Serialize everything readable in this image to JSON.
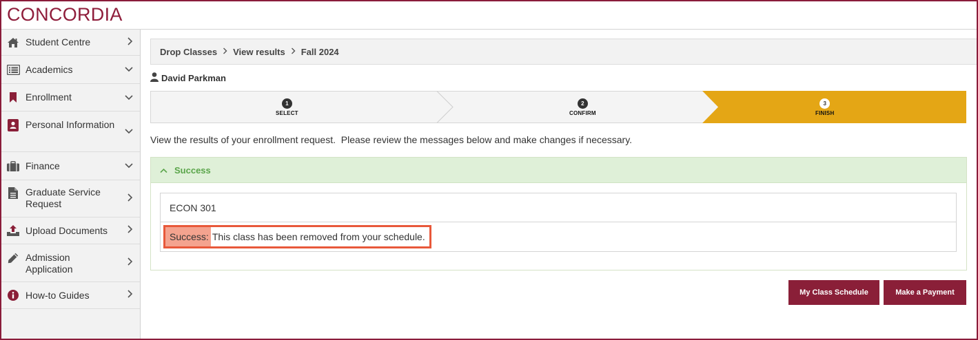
{
  "header": {
    "logo_text": "CONCORDIA",
    "brand_color": "#8f1d3b"
  },
  "sidebar": {
    "items": [
      {
        "label": "Student Centre",
        "icon": "home-icon",
        "chevron": "right"
      },
      {
        "label": "Academics",
        "icon": "list-icon",
        "chevron": "down"
      },
      {
        "label": "Enrollment",
        "icon": "bookmark-icon",
        "chevron": "down"
      },
      {
        "label": "Personal Information",
        "icon": "contact-card-icon",
        "chevron": "down"
      },
      {
        "label": "Finance",
        "icon": "briefcase-icon",
        "chevron": "down"
      },
      {
        "label": "Graduate Service Request",
        "icon": "document-icon",
        "chevron": "right"
      },
      {
        "label": "Upload Documents",
        "icon": "upload-icon",
        "chevron": "right"
      },
      {
        "label": "Admission Application",
        "icon": "pencil-icon",
        "chevron": "right"
      },
      {
        "label": "How-to Guides",
        "icon": "info-icon",
        "chevron": "right"
      }
    ]
  },
  "breadcrumb": {
    "items": [
      "Drop Classes",
      "View results",
      "Fall 2024"
    ]
  },
  "user": {
    "name": "David Parkman"
  },
  "steps": [
    {
      "number": "1",
      "label": "SELECT"
    },
    {
      "number": "2",
      "label": "CONFIRM"
    },
    {
      "number": "3",
      "label": "FINISH"
    }
  ],
  "steps_active_color": "#e4a615",
  "intro_text": "View the results of your enrollment request.  Please review the messages below and make changes if necessary.",
  "result": {
    "heading": "Success",
    "course": "ECON 301",
    "status_prefix": "Success:",
    "status_message": "This class has been removed from your schedule."
  },
  "buttons": {
    "schedule": "My Class Schedule",
    "payment": "Make a Payment"
  }
}
